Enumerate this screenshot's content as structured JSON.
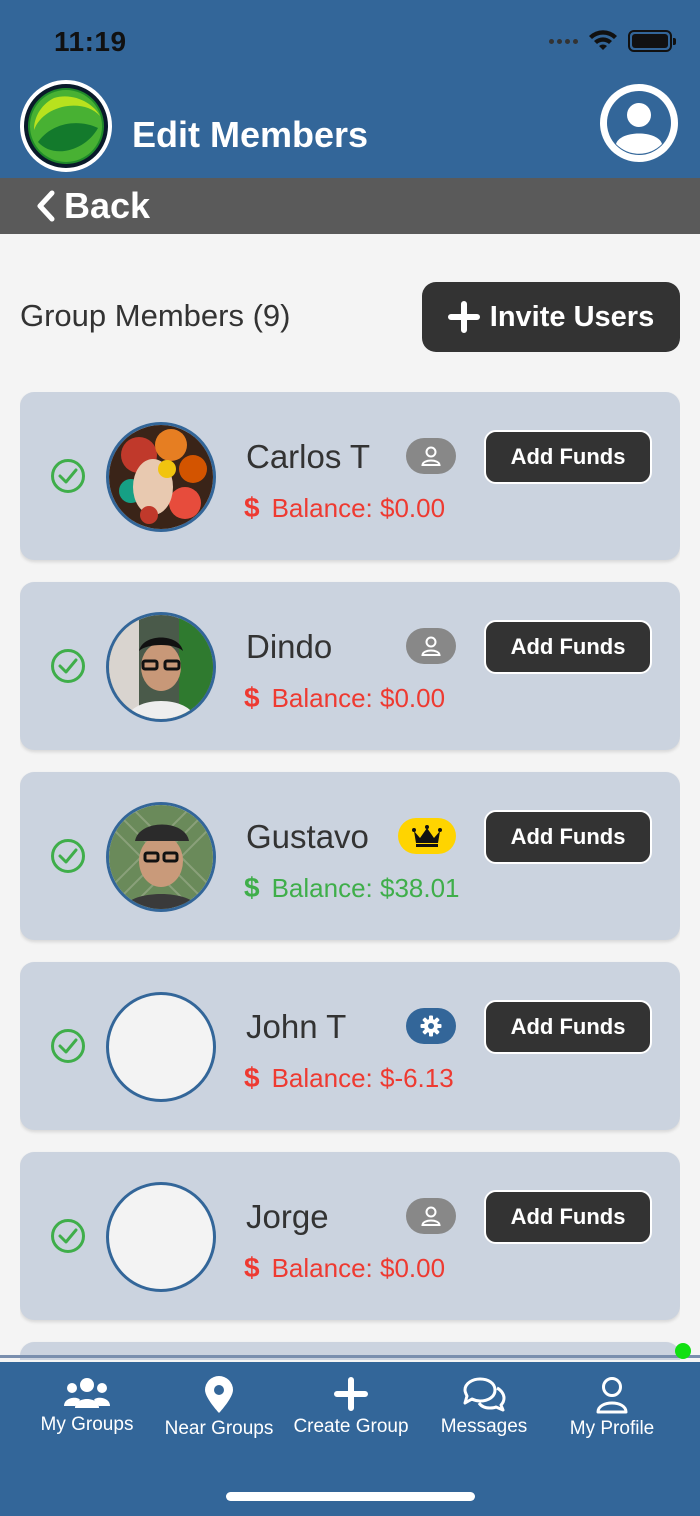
{
  "status_bar": {
    "time": "11:19"
  },
  "header": {
    "title": "Edit Members"
  },
  "back": {
    "label": "Back"
  },
  "section": {
    "title": "Group Members (9)",
    "invite_label": "Invite Users"
  },
  "members": [
    {
      "name": "Carlos T",
      "role": "member",
      "role_icon": "user-icon",
      "balance": "Balance: $0.00",
      "balance_color": "#ee3a31",
      "has_photo": true,
      "button": "Add Funds"
    },
    {
      "name": "Dindo",
      "role": "member",
      "role_icon": "user-icon",
      "balance": "Balance: $0.00",
      "balance_color": "#ee3a31",
      "has_photo": true,
      "button": "Add Funds"
    },
    {
      "name": "Gustavo",
      "role": "owner",
      "role_icon": "crown-icon",
      "balance": "Balance: $38.01",
      "balance_color": "#3fae4a",
      "has_photo": true,
      "button": "Add Funds"
    },
    {
      "name": "John T",
      "role": "admin",
      "role_icon": "gear-icon",
      "balance": "Balance: $-6.13",
      "balance_color": "#ee3a31",
      "has_photo": false,
      "button": "Add Funds"
    },
    {
      "name": "Jorge",
      "role": "member",
      "role_icon": "user-icon",
      "balance": "Balance: $0.00",
      "balance_color": "#ee3a31",
      "has_photo": false,
      "button": "Add Funds"
    }
  ],
  "tabbar": {
    "items": [
      {
        "label": "My Groups",
        "icon": "users-icon"
      },
      {
        "label": "Near Groups",
        "icon": "map-pin-icon"
      },
      {
        "label": "Create Group",
        "icon": "plus-icon"
      },
      {
        "label": "Messages",
        "icon": "chat-icon"
      },
      {
        "label": "My Profile",
        "icon": "user-icon"
      }
    ]
  },
  "colors": {
    "primary": "#336699",
    "backbar": "#5a5a5a",
    "card": "#cbd3df",
    "danger": "#ee3a31",
    "success": "#3fae4a",
    "owner_badge": "#ffd400",
    "member_badge": "#888888"
  }
}
